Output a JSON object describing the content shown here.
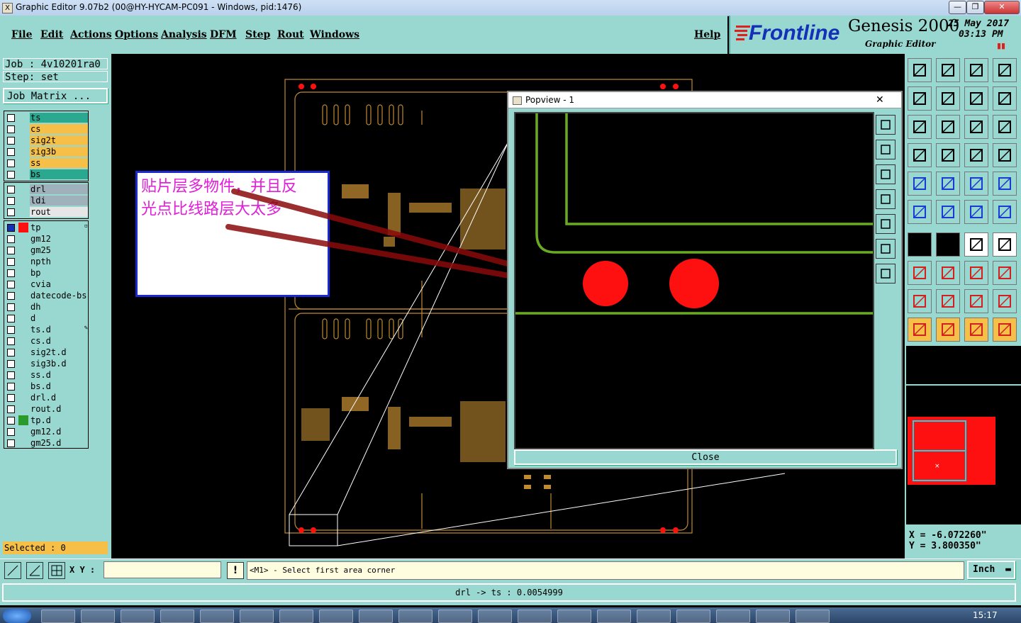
{
  "window": {
    "title": "Graphic Editor 9.07b2 (00@HY-HYCAM-PC091 - Windows, pid:1476)",
    "minimize": "—",
    "maximize": "❐",
    "close": "✕"
  },
  "menu": {
    "items": [
      "File",
      "Edit",
      "Actions",
      "Options",
      "Analysis",
      "DFM",
      "Step",
      "Rout",
      "Windows"
    ],
    "help": "Help"
  },
  "branding": {
    "logo": "Frontline",
    "product": "Genesis 2000",
    "subtitle": "Graphic Editor",
    "date": "25 May 2017",
    "time": "03:13  PM",
    "pause_glyph": "▮▮",
    "accent_color": "#e0201c"
  },
  "job": {
    "job_label": "Job  : 4v10201ra0",
    "step_label": "Step: set",
    "matrix_button": "Job Matrix ..."
  },
  "layers": {
    "board": [
      {
        "name": "ts",
        "color": "#2aa890"
      },
      {
        "name": "cs",
        "color": "#f6c048"
      },
      {
        "name": "sig2t",
        "color": "#f6c048"
      },
      {
        "name": "sig3b",
        "color": "#f6c048"
      },
      {
        "name": "ss",
        "color": "#f6c048"
      },
      {
        "name": "bs",
        "color": "#2aa890"
      }
    ],
    "drill": [
      {
        "name": "drl",
        "color": "#9fb2bc"
      },
      {
        "name": "ldi",
        "color": "#9fb2bc"
      },
      {
        "name": "rout",
        "color": "#e6e6e6"
      }
    ],
    "misc": [
      {
        "name": "tp",
        "color": "#98d8d0",
        "swatch": "#ff1010",
        "active": true,
        "marker": "▫"
      },
      {
        "name": "gm12",
        "color": "#98d8d0"
      },
      {
        "name": "gm25",
        "color": "#98d8d0"
      },
      {
        "name": "npth",
        "color": "#98d8d0"
      },
      {
        "name": "bp",
        "color": "#98d8d0"
      },
      {
        "name": "cvia",
        "color": "#98d8d0"
      },
      {
        "name": "datecode-bs",
        "color": "#98d8d0"
      },
      {
        "name": "dh",
        "color": "#98d8d0"
      },
      {
        "name": "d",
        "color": "#98d8d0"
      },
      {
        "name": "ts.d",
        "color": "#98d8d0",
        "marker": "✎"
      },
      {
        "name": "cs.d",
        "color": "#98d8d0"
      },
      {
        "name": "sig2t.d",
        "color": "#98d8d0"
      },
      {
        "name": "sig3b.d",
        "color": "#98d8d0"
      },
      {
        "name": "ss.d",
        "color": "#98d8d0"
      },
      {
        "name": "bs.d",
        "color": "#98d8d0"
      },
      {
        "name": "drl.d",
        "color": "#98d8d0"
      },
      {
        "name": "rout.d",
        "color": "#98d8d0"
      },
      {
        "name": "tp.d",
        "color": "#98d8d0",
        "swatch": "#2a9a2a"
      },
      {
        "name": "gm12.d",
        "color": "#98d8d0"
      },
      {
        "name": "gm25.d",
        "color": "#98d8d0"
      }
    ]
  },
  "selected": "Selected : 0",
  "popview": {
    "title": "Popview - 1",
    "close_button": "Close",
    "close_glyph": "✕"
  },
  "annotation": {
    "line1": "贴片层多物件，并且反",
    "line2": "光点比线路层大太多",
    "color": "#e020d8"
  },
  "coords": {
    "x": "X  = -6.072260\"",
    "y": "Y  = 3.800350\""
  },
  "command": {
    "xy_label": "X Y :",
    "input_value": "",
    "bang": "!",
    "prompt": "<M1> - Select first area corner",
    "units": "Inch"
  },
  "status": {
    "message": "drl -> ts : 0.0054999"
  },
  "taskbar": {
    "clock": "15:17"
  },
  "tools": {
    "row_icons": [
      "home-up-icon",
      "home-down-icon",
      "house-icon",
      "layout-icon",
      "pan-left-icon",
      "pan-right-icon",
      "zoom-fit-icon",
      "layer-shift-icon",
      "zoom-home-icon",
      "zoom-all-icon",
      "ratio-icon",
      "help-icon",
      "measure-icon",
      "probe-icon",
      "snap-grid-icon",
      "snap-red-icon",
      "feature-pad-icon",
      "feature-select-icon",
      "ruler-icon",
      "circle-icon",
      "net-icon",
      "cross-icon",
      "add-line-icon",
      "add-arc-icon",
      "angle-icon",
      "slash-icon",
      "rotate-icon",
      "flip-icon",
      "move-icon",
      "line-icon",
      "frame-icon",
      "copy-icon",
      "triangle-1-icon",
      "triangle-2-icon",
      "triangle-3-icon",
      "triangle-4-icon",
      "pointer-icon",
      "pointer-box-icon",
      "pointer-circle-icon",
      "pointer-path-icon"
    ],
    "popview_icons": [
      "pv-layers-icon",
      "pv-up-icon",
      "pv-down-icon",
      "pv-left-icon",
      "pv-right-icon",
      "pv-fit-icon",
      "pv-zoom-icon"
    ]
  }
}
